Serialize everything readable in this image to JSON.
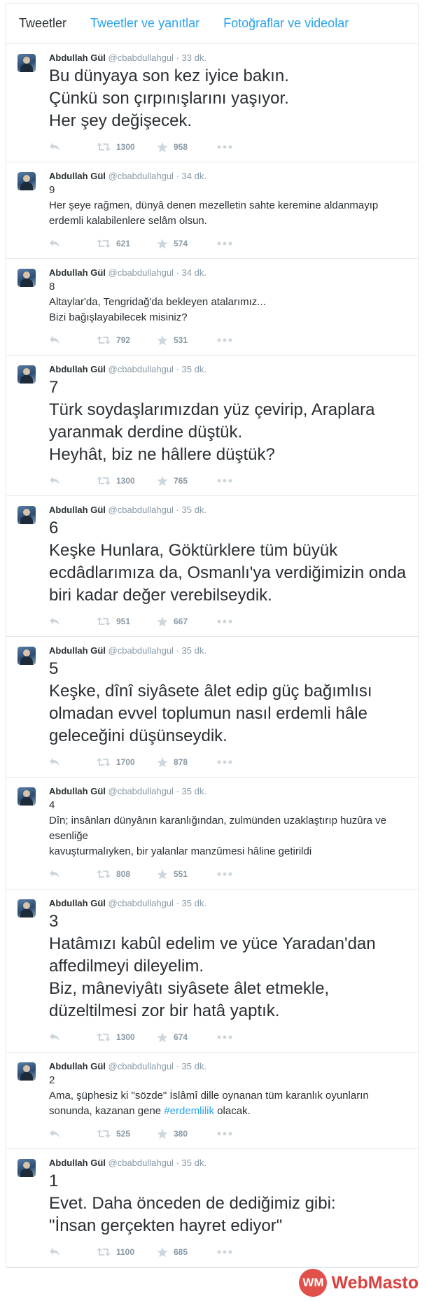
{
  "tabs": [
    "Tweetler",
    "Tweetler ve yanıtlar",
    "Fotoğraflar ve videolar"
  ],
  "tweets": [
    {
      "name": "Abdullah Gül",
      "handle": "@cbabdullahgul",
      "time": "· 33 dk.",
      "size": "big",
      "text": "Bu dünyaya son kez iyice bakın.\nÇünkü son çırpınışlarını yaşıyor.\nHer şey değişecek.",
      "retweets": "1300",
      "favorites": "958"
    },
    {
      "name": "Abdullah Gül",
      "handle": "@cbabdullahgul",
      "time": "· 34 dk.",
      "size": "small",
      "text": "9\nHer şeye rağmen, dünyâ denen mezelletin sahte keremine aldanmayıp erdemli kalabilenlere selâm olsun.",
      "retweets": "621",
      "favorites": "574"
    },
    {
      "name": "Abdullah Gül",
      "handle": "@cbabdullahgul",
      "time": "· 34 dk.",
      "size": "small",
      "text": "8\nAltaylar'da, Tengridağ'da bekleyen atalarımız...\nBizi bağışlayabilecek misiniz?",
      "retweets": "792",
      "favorites": "531"
    },
    {
      "name": "Abdullah Gül",
      "handle": "@cbabdullahgul",
      "time": "· 35 dk.",
      "size": "big",
      "text": "7\nTürk soydaşlarımızdan yüz çevirip, Araplara yaranmak derdine düştük.\nHeyhât, biz ne hâllere düştük?",
      "retweets": "1300",
      "favorites": "765"
    },
    {
      "name": "Abdullah Gül",
      "handle": "@cbabdullahgul",
      "time": "· 35 dk.",
      "size": "big",
      "text": "6\nKeşke Hunlara, Göktürklere tüm büyük ecdâdlarımıza da, Osmanlı'ya verdiğimizin onda biri kadar değer verebilseydik.",
      "retweets": "951",
      "favorites": "667"
    },
    {
      "name": "Abdullah Gül",
      "handle": "@cbabdullahgul",
      "time": "· 35 dk.",
      "size": "big",
      "text": "5\nKeşke, dînî siyâsete âlet edip güç bağımlısı olmadan evvel toplumun nasıl erdemli hâle geleceğini düşünseydik.",
      "retweets": "1700",
      "favorites": "878"
    },
    {
      "name": "Abdullah Gül",
      "handle": "@cbabdullahgul",
      "time": "· 35 dk.",
      "size": "small",
      "text": "4\nDîn; insânları dünyânın karanlığından, zulmünden uzaklaştırıp huzûra ve esenliğe\nkavuşturmalıyken, bir yalanlar manzûmesi hâline getirildi",
      "retweets": "808",
      "favorites": "551"
    },
    {
      "name": "Abdullah Gül",
      "handle": "@cbabdullahgul",
      "time": "· 35 dk.",
      "size": "big",
      "text": "3\nHatâmızı kabûl edelim ve yüce Yaradan'dan affedilmeyi dileyelim.\nBiz, mâneviyâtı siyâsete âlet etmekle, düzeltilmesi zor bir hatâ yaptık.",
      "retweets": "1300",
      "favorites": "674"
    },
    {
      "name": "Abdullah Gül",
      "handle": "@cbabdullahgul",
      "time": "· 35 dk.",
      "size": "small",
      "text": "2\nAma, şüphesiz ki \"sözde\" İslâmî dille oynanan tüm karanlık oyunların sonunda, kazanan gene ",
      "hashtag": "#erdemlilik",
      "text_after": " olacak.",
      "retweets": "525",
      "favorites": "380"
    },
    {
      "name": "Abdullah Gül",
      "handle": "@cbabdullahgul",
      "time": "· 35 dk.",
      "size": "big",
      "text": "1\nEvet. Daha önceden de dediğimiz gibi:\n\"İnsan gerçekten hayret ediyor\"",
      "retweets": "1100",
      "favorites": "685"
    }
  ],
  "watermark": {
    "logo": "WM",
    "text": "WebMasto"
  },
  "colors": {
    "link": "#2aa3ef",
    "muted": "#8899a6",
    "border": "#e1e8ed",
    "watermark": "#d8413f"
  },
  "icons": [
    "reply-icon",
    "retweet-icon",
    "favorite-icon",
    "more-icon"
  ]
}
